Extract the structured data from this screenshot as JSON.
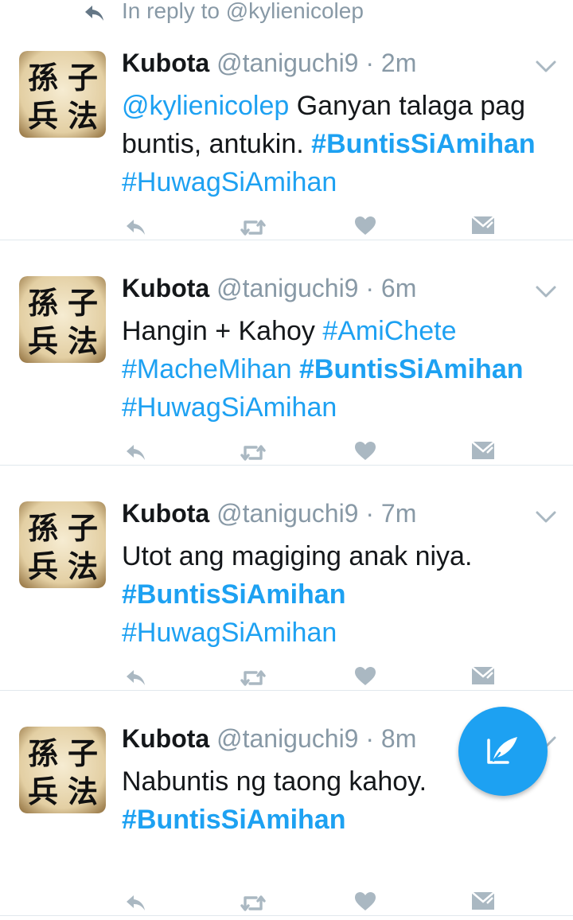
{
  "reply_context": {
    "text": "In reply to @kylienicolep"
  },
  "tweets": [
    {
      "author": {
        "name": "Kubota",
        "handle": "@taniguchi9",
        "avatar_chars": [
          "孫",
          "子",
          "兵",
          "法"
        ]
      },
      "separator": "·",
      "time": "2m",
      "segments": [
        {
          "type": "mention",
          "text": "@kylienicolep"
        },
        {
          "type": "text",
          "text": " Ganyan talaga pag buntis, antukin. "
        },
        {
          "type": "hashtag",
          "bold": true,
          "text": "#BuntisSiAmihan"
        },
        {
          "type": "text",
          "text": " "
        },
        {
          "type": "hashtag",
          "bold": false,
          "text": "#HuwagSiAmihan"
        }
      ]
    },
    {
      "author": {
        "name": "Kubota",
        "handle": "@taniguchi9",
        "avatar_chars": [
          "孫",
          "子",
          "兵",
          "法"
        ]
      },
      "separator": "·",
      "time": "6m",
      "segments": [
        {
          "type": "text",
          "text": "Hangin + Kahoy "
        },
        {
          "type": "hashtag",
          "bold": false,
          "text": "#AmiChete"
        },
        {
          "type": "text",
          "text": " "
        },
        {
          "type": "hashtag",
          "bold": false,
          "text": "#MacheMihan"
        },
        {
          "type": "text",
          "text": " "
        },
        {
          "type": "hashtag",
          "bold": true,
          "text": "#BuntisSiAmihan"
        },
        {
          "type": "text",
          "text": " "
        },
        {
          "type": "hashtag",
          "bold": false,
          "text": "#HuwagSiAmihan"
        }
      ]
    },
    {
      "author": {
        "name": "Kubota",
        "handle": "@taniguchi9",
        "avatar_chars": [
          "孫",
          "子",
          "兵",
          "法"
        ]
      },
      "separator": "·",
      "time": "7m",
      "segments": [
        {
          "type": "text",
          "text": "Utot ang magiging anak niya. "
        },
        {
          "type": "hashtag",
          "bold": true,
          "text": "#BuntisSiAmihan"
        },
        {
          "type": "text",
          "text": " "
        },
        {
          "type": "hashtag",
          "bold": false,
          "text": "#HuwagSiAmihan"
        }
      ]
    },
    {
      "author": {
        "name": "Kubota",
        "handle": "@taniguchi9",
        "avatar_chars": [
          "孫",
          "子",
          "兵",
          "法"
        ]
      },
      "separator": "·",
      "time": "8m",
      "segments": [
        {
          "type": "text",
          "text": "Nabuntis ng taong kahoy. "
        },
        {
          "type": "hashtag",
          "bold": true,
          "text": "#BuntisSiAmihan"
        }
      ]
    }
  ],
  "icons": {
    "reply": "reply-icon",
    "retweet": "retweet-icon",
    "like": "heart-icon",
    "dm": "direct-message-icon",
    "caret": "chevron-down-icon",
    "compose": "compose-tweet-icon"
  },
  "colors": {
    "accent": "#1da1f2",
    "secondary_text": "#8899a6",
    "action_icons": "#aab8c2",
    "divider": "#e1e8ed"
  }
}
